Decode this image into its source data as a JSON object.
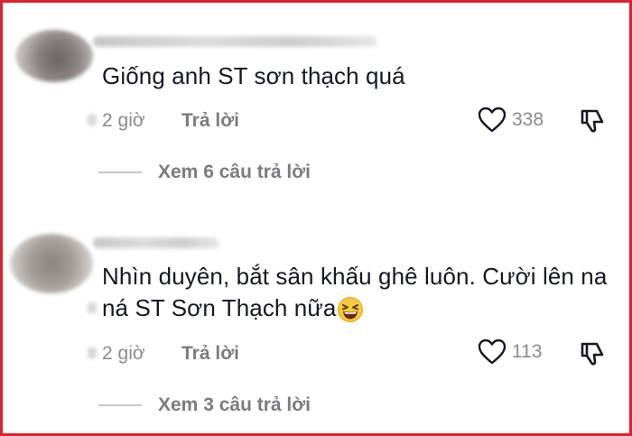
{
  "comments": [
    {
      "text": "Giống anh ST sơn thạch quá",
      "time": "2 giờ",
      "reply_label": "Trả lời",
      "likes": "338",
      "view_replies": "Xem 6 câu trả lời"
    },
    {
      "text": "Nhìn duyên, bắt sân khấu ghê luôn. Cười lên na ná ST Sơn Thạch nữa",
      "time": "2 giờ",
      "reply_label": "Trả lời",
      "likes": "113",
      "view_replies": "Xem 3 câu trả lời",
      "emoji": "grinning-squinting-face"
    }
  ],
  "colors": {
    "frame_border": "#d8232a",
    "text": "#161823",
    "muted": "#8a8b91"
  }
}
